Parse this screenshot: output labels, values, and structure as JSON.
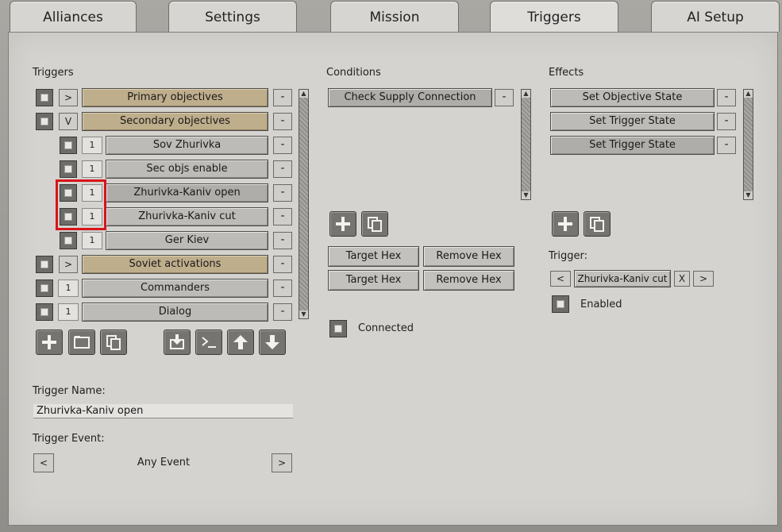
{
  "tabs": [
    "Alliances",
    "Settings",
    "Mission",
    "Triggers",
    "AI Setup"
  ],
  "triggers": {
    "heading": "Triggers",
    "rows": [
      {
        "expander": ">",
        "label": "Primary objectives",
        "style": "gold",
        "indent": false
      },
      {
        "expander": "V",
        "label": "Secondary objectives",
        "style": "gold",
        "indent": false
      },
      {
        "expander": "1",
        "label": "Sov Zhurivka",
        "style": "plain",
        "indent": true
      },
      {
        "expander": "1",
        "label": "Sec objs enable",
        "style": "plain",
        "indent": true
      },
      {
        "expander": "1",
        "label": "Zhurivka-Kaniv open",
        "style": "selected",
        "indent": true
      },
      {
        "expander": "1",
        "label": "Zhurivka-Kaniv cut",
        "style": "plain",
        "indent": true
      },
      {
        "expander": "1",
        "label": "Ger Kiev",
        "style": "plain",
        "indent": true
      },
      {
        "expander": ">",
        "label": "Soviet activations",
        "style": "gold",
        "indent": false
      },
      {
        "expander": "1",
        "label": "Commanders",
        "style": "plain",
        "indent": false
      },
      {
        "expander": "1",
        "label": "Dialog",
        "style": "plain",
        "indent": false
      }
    ],
    "remove_label": "-",
    "toolbar_icons": [
      "add-icon",
      "folder-icon",
      "copy-icon",
      "import-icon",
      "console-icon",
      "arrow-up-icon",
      "arrow-down-icon"
    ]
  },
  "trigger_name": {
    "label": "Trigger Name:",
    "value": "Zhurivka-Kaniv open"
  },
  "trigger_event": {
    "label": "Trigger Event:",
    "prev": "<",
    "value": "Any Event",
    "next": ">"
  },
  "conditions": {
    "heading": "Conditions",
    "items": [
      "Check Supply Connection"
    ],
    "remove_label": "-",
    "hex_buttons": [
      {
        "target": "Target Hex",
        "remove": "Remove Hex"
      },
      {
        "target": "Target Hex",
        "remove": "Remove Hex"
      }
    ],
    "connected_label": "Connected"
  },
  "effects": {
    "heading": "Effects",
    "items": [
      "Set Objective State",
      "Set Trigger State",
      "Set Trigger State"
    ],
    "remove_label": "-",
    "trigger_label": "Trigger:",
    "trigger_prev": "<",
    "trigger_value": "Zhurivka-Kaniv cut",
    "trigger_clear": "X",
    "trigger_next": ">",
    "enabled_label": "Enabled"
  },
  "colors": {
    "highlight": "#d8141a",
    "gold_row": "#bfae8c"
  }
}
